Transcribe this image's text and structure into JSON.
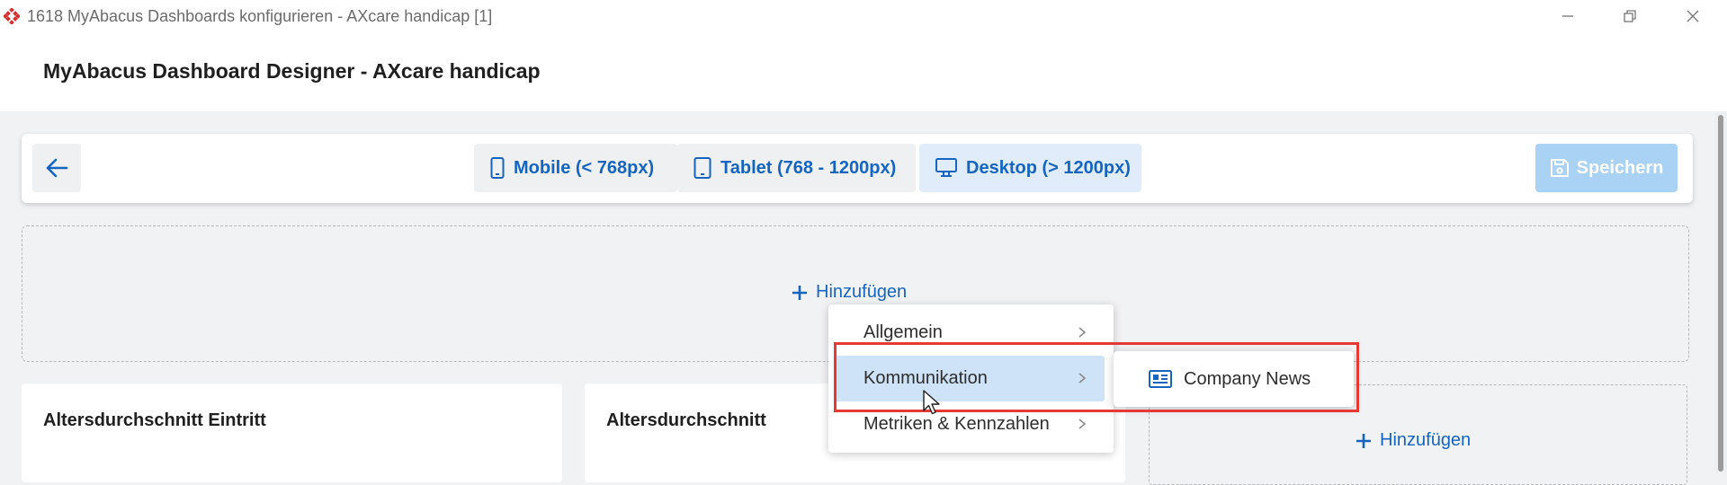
{
  "window": {
    "title": "1618 MyAbacus Dashboards konfigurieren - AXcare handicap [1]"
  },
  "page": {
    "title": "MyAbacus Dashboard Designer - AXcare handicap"
  },
  "toolbar": {
    "devices": [
      {
        "label": "Mobile (< 768px)",
        "icon": "mobile-icon"
      },
      {
        "label": "Tablet (768 - 1200px)",
        "icon": "tablet-icon"
      },
      {
        "label": "Desktop (> 1200px)",
        "icon": "desktop-icon"
      }
    ],
    "save_label": "Speichern"
  },
  "dropzone": {
    "add_label": "Hinzufügen"
  },
  "cards": [
    {
      "title": "Altersdurchschnitt Eintritt"
    },
    {
      "title": "Altersdurchschnitt"
    }
  ],
  "card_add_label": "Hinzufügen",
  "menu": {
    "items": [
      {
        "label": "Allgemein"
      },
      {
        "label": "Kommunikation"
      },
      {
        "label": "Metriken & Kennzahlen"
      }
    ],
    "active": "Kommunikation"
  },
  "submenu": {
    "items": [
      {
        "label": "Company News",
        "icon": "news-icon"
      }
    ]
  },
  "colors": {
    "accent": "#1565c0",
    "active_bg": "#cfe3f8",
    "highlight": "#e53935"
  }
}
